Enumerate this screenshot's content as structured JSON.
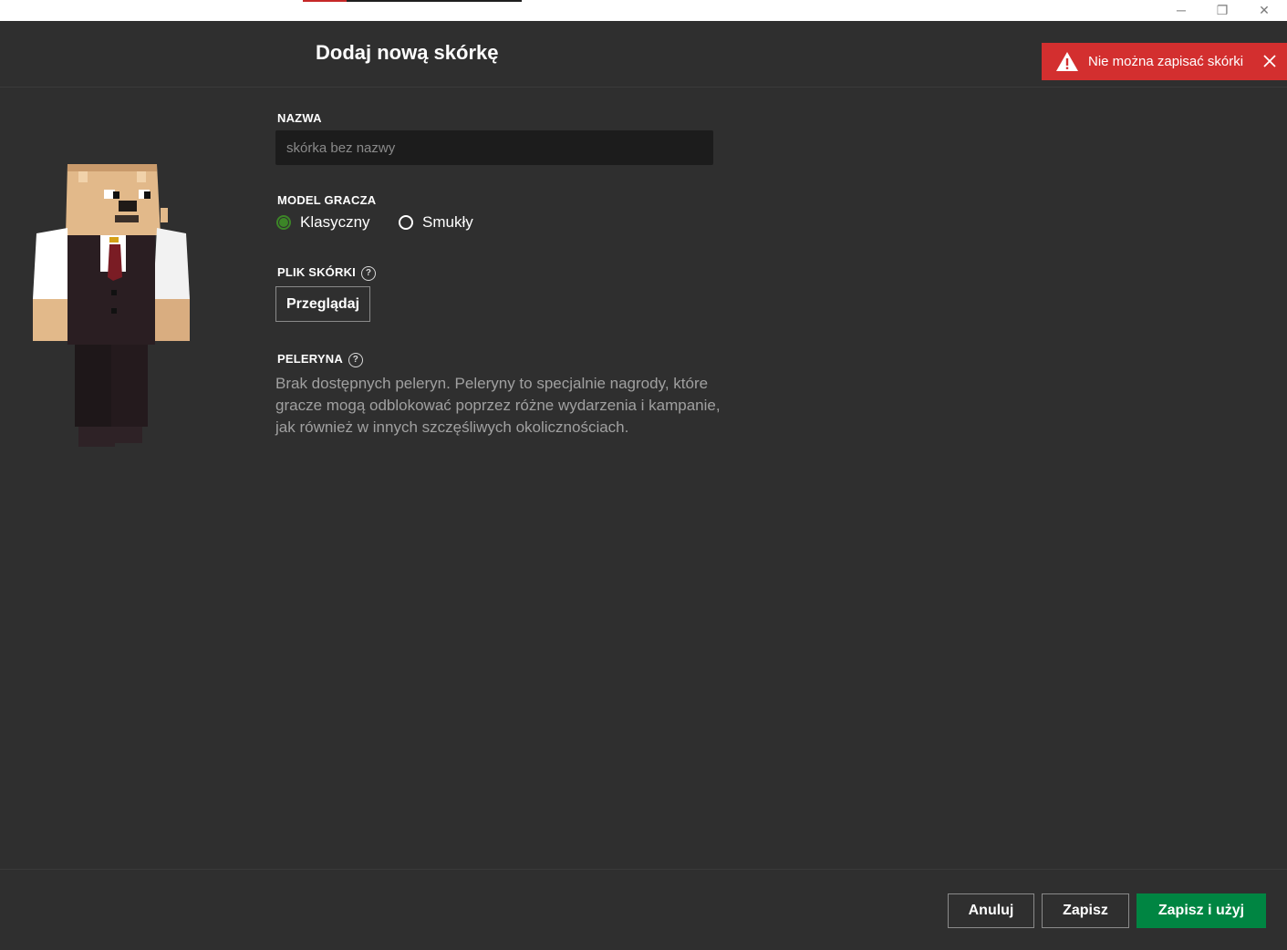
{
  "window": {
    "minimize_glyph": "─",
    "restore_glyph": "❐",
    "close_glyph": "✕"
  },
  "header": {
    "title": "Dodaj nową skórkę"
  },
  "toast": {
    "message": "Nie można zapisać skórki",
    "color": "#d32f2f"
  },
  "form": {
    "name_label": "NAZWA",
    "name_placeholder": "skórka bez nazwy",
    "name_value": "",
    "model_label": "MODEL GRACZA",
    "model_options": [
      {
        "label": "Klasyczny",
        "selected": true
      },
      {
        "label": "Smukły",
        "selected": false
      }
    ],
    "skin_file_label": "PLIK SKÓRKI",
    "browse_label": "Przeglądaj",
    "cape_label": "PELERYNA",
    "cape_description": "Brak dostępnych peleryn. Peleryny to specjalnie nagrody, które gracze mogą odblokować poprzez różne wydarzenia i kampanie, jak również w innych szczęśliwych okolicznościach.",
    "help_glyph": "?"
  },
  "footer": {
    "cancel_label": "Anuluj",
    "save_label": "Zapisz",
    "save_use_label": "Zapisz i użyj",
    "accent_color": "#008542"
  }
}
